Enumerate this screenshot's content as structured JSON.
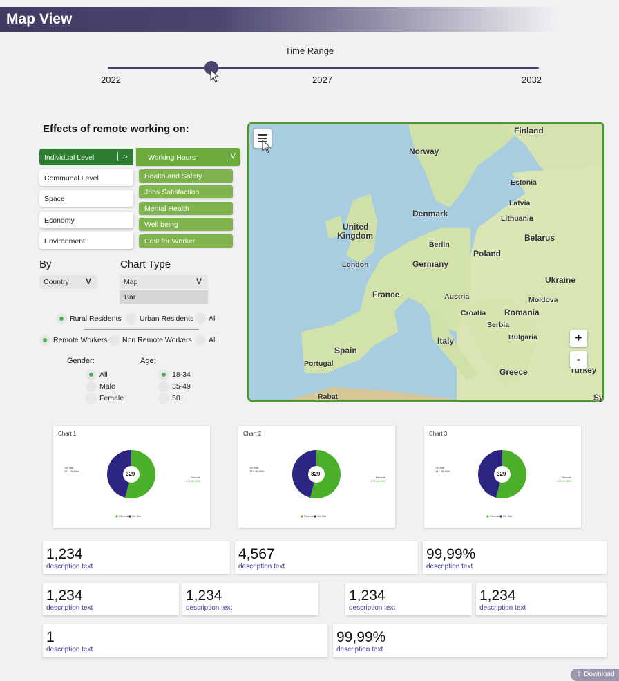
{
  "header": {
    "title": "Map View"
  },
  "time_range": {
    "title": "Time Range",
    "ticks": [
      "2022",
      "2027",
      "2032"
    ],
    "value_fraction": 0.24
  },
  "effects": {
    "title": "Effects of remote working on:",
    "categories": [
      "Individual Level",
      "Communal Level",
      "Space",
      "Economy",
      "Environment"
    ],
    "active_category_chevron": ">",
    "subcategory_header": "Working Hours",
    "subcategory_chevron": "V",
    "subcategories": [
      "Health and Safety",
      "Jobs Satisfaction",
      "Mental Health",
      "Well being",
      "Cost for Worker"
    ]
  },
  "filters": {
    "by_label": "By",
    "by_value": "Country",
    "chart_type_label": "Chart Type",
    "chart_type_value": "Map",
    "chart_type_option": "Bar",
    "dropdown_chevron": "V",
    "residents": [
      "Rural Residents",
      "Urban Residents",
      "All"
    ],
    "workers": [
      "Remote Workers",
      "Non Remote Workers",
      "All"
    ],
    "gender_label": "Gender:",
    "gender": [
      "All",
      "Male",
      "Female"
    ],
    "age_label": "Age:",
    "age": [
      "18-34",
      "35-49",
      "50+"
    ]
  },
  "map": {
    "labels": [
      "Finland",
      "Norway",
      "Estonia",
      "Latvia",
      "Denmark",
      "Lithuania",
      "United",
      "Kingdom",
      "Berlin",
      "Belarus",
      "Poland",
      "London",
      "Germany",
      "Ukraine",
      "France",
      "Austria",
      "Moldova",
      "Romania",
      "Croatia",
      "Serbia",
      "Bulgaria",
      "Italy",
      "Spain",
      "Portugal",
      "Greece",
      "Turkey",
      "Rabat",
      "Sy"
    ],
    "zoom_in": "+",
    "zoom_out": "-",
    "colors": {
      "water": "#a8cde0",
      "land": "#cfe0a8",
      "border": "#4c9a2a"
    }
  },
  "charts": [
    {
      "title": "Chart 1",
      "total": "329",
      "left_label": "On Site",
      "left_value": "151  45.90%",
      "right_label": "Remote",
      "right_value": "178  54.10%",
      "legend": [
        "Remote",
        "On Site"
      ],
      "values": [
        178,
        151
      ]
    },
    {
      "title": "Chart 2",
      "total": "329",
      "left_label": "On Site",
      "left_value": "151  45.90%",
      "right_label": "Remote",
      "right_value": "178  54.10%",
      "legend": [
        "Remote",
        "On Site"
      ],
      "values": [
        178,
        151
      ]
    },
    {
      "title": "Chart 3",
      "total": "329",
      "left_label": "On Site",
      "left_value": "151  45.90%",
      "right_label": "Remote",
      "right_value": "178  54.10%",
      "legend": [
        "Remote",
        "On Site"
      ],
      "values": [
        178,
        151
      ]
    }
  ],
  "chart_colors": {
    "remote": "#4caf2a",
    "onsite": "#2c2582"
  },
  "kpis": {
    "row1": [
      {
        "value": "1,234",
        "desc": "description text"
      },
      {
        "value": "4,567",
        "desc": "description text"
      },
      {
        "value": "99,99%",
        "desc": "description text"
      }
    ],
    "row2": [
      {
        "value": "1,234",
        "desc": "description text"
      },
      {
        "value": "1,234",
        "desc": "description text"
      },
      {
        "value": "1,234",
        "desc": "description text"
      },
      {
        "value": "1,234",
        "desc": "description text"
      }
    ],
    "row3": [
      {
        "value": "1",
        "desc": "description text"
      },
      {
        "value": "99,99%",
        "desc": "description text"
      }
    ]
  },
  "download": {
    "label": "Download",
    "icon": "share-icon"
  }
}
